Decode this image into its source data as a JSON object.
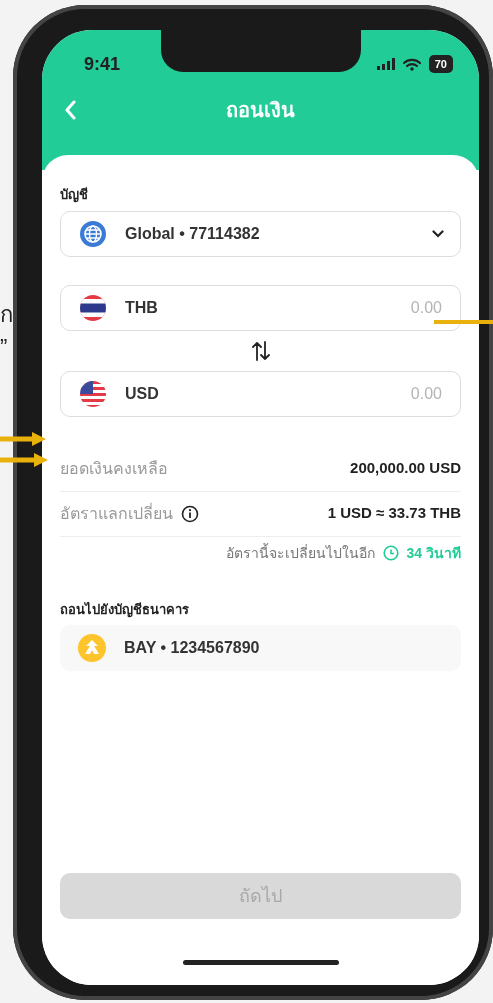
{
  "status_bar": {
    "time": "9:41",
    "battery": "70"
  },
  "header": {
    "title": "ถอนเงิน"
  },
  "account": {
    "label": "บัญชี",
    "value": "Global • 77114382"
  },
  "amounts": [
    {
      "kind": "th",
      "currency": "THB",
      "placeholder": "0.00"
    },
    {
      "kind": "us",
      "currency": "USD",
      "placeholder": "0.00"
    }
  ],
  "details": [
    {
      "label": "ยอดเงินคงเหลือ",
      "value": "200,000.00 USD",
      "info": false
    },
    {
      "label": "อัตราแลกเปลี่ยน",
      "value": "1 USD ≈ 33.73 THB",
      "info": true
    }
  ],
  "countdown": {
    "text": "อัตรานี้จะเปลี่ยนไปในอีก",
    "time": "34 วินาที"
  },
  "bank": {
    "label": "ถอนไปยังบัญชีธนาคาร",
    "value": "BAY • 1234567890"
  },
  "next_button": {
    "label": "ถัดไป",
    "disabled": true
  },
  "annotations": [
    {
      "text": "ก"
    },
    {
      "text": "”"
    }
  ]
}
